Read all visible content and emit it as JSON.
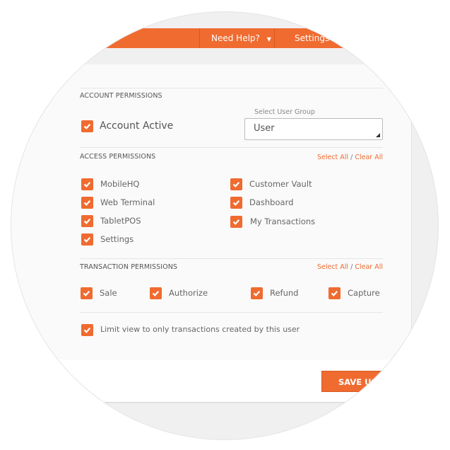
{
  "colors": {
    "accent": "#f06b30",
    "panel": "#fafafa",
    "background": "#f0f0f0"
  },
  "nav": {
    "help_label": "Need Help?",
    "help_icon": "caret-down-icon",
    "settings_label": "Settings"
  },
  "account": {
    "section_title": "ACCOUNT PERMISSIONS",
    "active_label": "Account Active",
    "active_checked": true,
    "group_label": "Select User Group",
    "group_value": "User"
  },
  "access": {
    "section_title": "ACCESS PERMISSIONS",
    "select_all": "Select All",
    "separator": "/",
    "clear_all": "Clear All",
    "items": [
      {
        "label": "MobileHQ",
        "checked": true
      },
      {
        "label": "Web Terminal",
        "checked": true
      },
      {
        "label": "TabletPOS",
        "checked": true
      },
      {
        "label": "Settings",
        "checked": true
      },
      {
        "label": "Customer Vault",
        "checked": true
      },
      {
        "label": "Dashboard",
        "checked": true
      },
      {
        "label": "My Transactions",
        "checked": true
      }
    ]
  },
  "transaction": {
    "section_title": "TRANSACTION PERMISSIONS",
    "select_all": "Select All",
    "separator": "/",
    "clear_all": "Clear All",
    "items": [
      {
        "label": "Sale",
        "checked": true
      },
      {
        "label": "Authorize",
        "checked": true
      },
      {
        "label": "Refund",
        "checked": true
      },
      {
        "label": "Capture",
        "checked": true
      }
    ],
    "limit_label": "Limit view to only transactions created by this user",
    "limit_checked": true
  },
  "save_button": "SAVE USER"
}
